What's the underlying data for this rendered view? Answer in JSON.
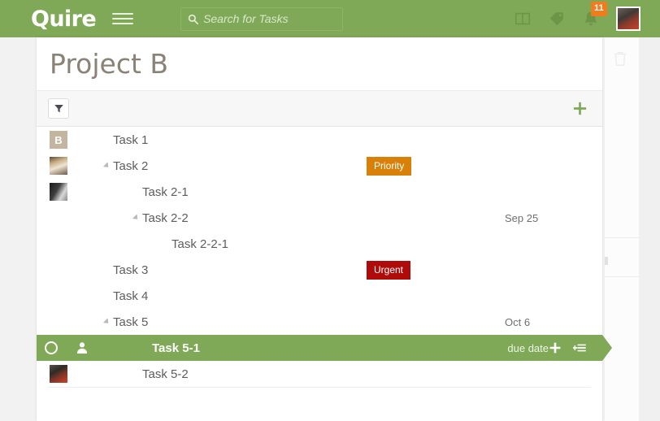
{
  "topbar": {
    "logo": "Quire",
    "menu_icon": "hamburger-menu-icon",
    "search": {
      "placeholder": "Search for Tasks",
      "value": "",
      "icon": "search-icon"
    },
    "icons": [
      {
        "name": "panel-layout-icon",
        "label": "Panel layout"
      },
      {
        "name": "tag-icon",
        "label": "Tags"
      },
      {
        "name": "bell-icon",
        "label": "Notifications",
        "badge": "11"
      }
    ],
    "avatar": {
      "name": "user-avatar",
      "label": ""
    },
    "accent_green": "#7fa956",
    "badge_color": "#f07c1e"
  },
  "page": {
    "title": "Project B"
  },
  "toolbar": {
    "filter_icon": "filter-funnel-icon",
    "add_icon": "plus-icon"
  },
  "tasks": [
    {
      "id": "task-1",
      "title": "Task 1",
      "indent": 0,
      "avatar": {
        "type": "initial",
        "text": "B"
      },
      "collapsible": false,
      "tag": null,
      "date": null,
      "selected": false
    },
    {
      "id": "task-2",
      "title": "Task 2",
      "indent": 0,
      "avatar": {
        "type": "photo-dog",
        "text": ""
      },
      "collapsible": true,
      "tag": {
        "label": "Priority",
        "color": "#d98008"
      },
      "date": null,
      "selected": false
    },
    {
      "id": "task-2-1",
      "title": "Task 2-1",
      "indent": 1,
      "avatar": {
        "type": "photo-dark",
        "text": ""
      },
      "collapsible": false,
      "tag": null,
      "date": null,
      "selected": false
    },
    {
      "id": "task-2-2",
      "title": "Task 2-2",
      "indent": 1,
      "avatar": null,
      "collapsible": true,
      "tag": null,
      "date": "Sep 25",
      "selected": false
    },
    {
      "id": "task-2-2-1",
      "title": "Task 2-2-1",
      "indent": 2,
      "avatar": null,
      "collapsible": false,
      "tag": null,
      "date": null,
      "selected": false
    },
    {
      "id": "task-3",
      "title": "Task 3",
      "indent": 0,
      "avatar": null,
      "collapsible": false,
      "tag": {
        "label": "Urgent",
        "color": "#b00b0b"
      },
      "date": null,
      "selected": false
    },
    {
      "id": "task-4",
      "title": "Task 4",
      "indent": 0,
      "avatar": null,
      "collapsible": false,
      "tag": null,
      "date": null,
      "selected": false
    },
    {
      "id": "task-5",
      "title": "Task 5",
      "indent": 0,
      "avatar": null,
      "collapsible": true,
      "tag": null,
      "date": "Oct 6",
      "selected": false
    },
    {
      "id": "task-5-1",
      "title": "Task 5-1",
      "indent": 1,
      "avatar": null,
      "collapsible": false,
      "tag": null,
      "date": "due date",
      "selected": true,
      "selected_actions": [
        {
          "name": "complete-toggle-icon"
        },
        {
          "name": "assignee-icon"
        },
        {
          "name": "add-subtask-icon"
        },
        {
          "name": "add-to-list-icon"
        }
      ]
    },
    {
      "id": "task-5-2",
      "title": "Task 5-2",
      "indent": 1,
      "avatar": {
        "type": "photo-red",
        "text": ""
      },
      "collapsible": false,
      "tag": null,
      "date": null,
      "selected": false
    }
  ],
  "background": {
    "trash_icon": "trash-icon"
  }
}
